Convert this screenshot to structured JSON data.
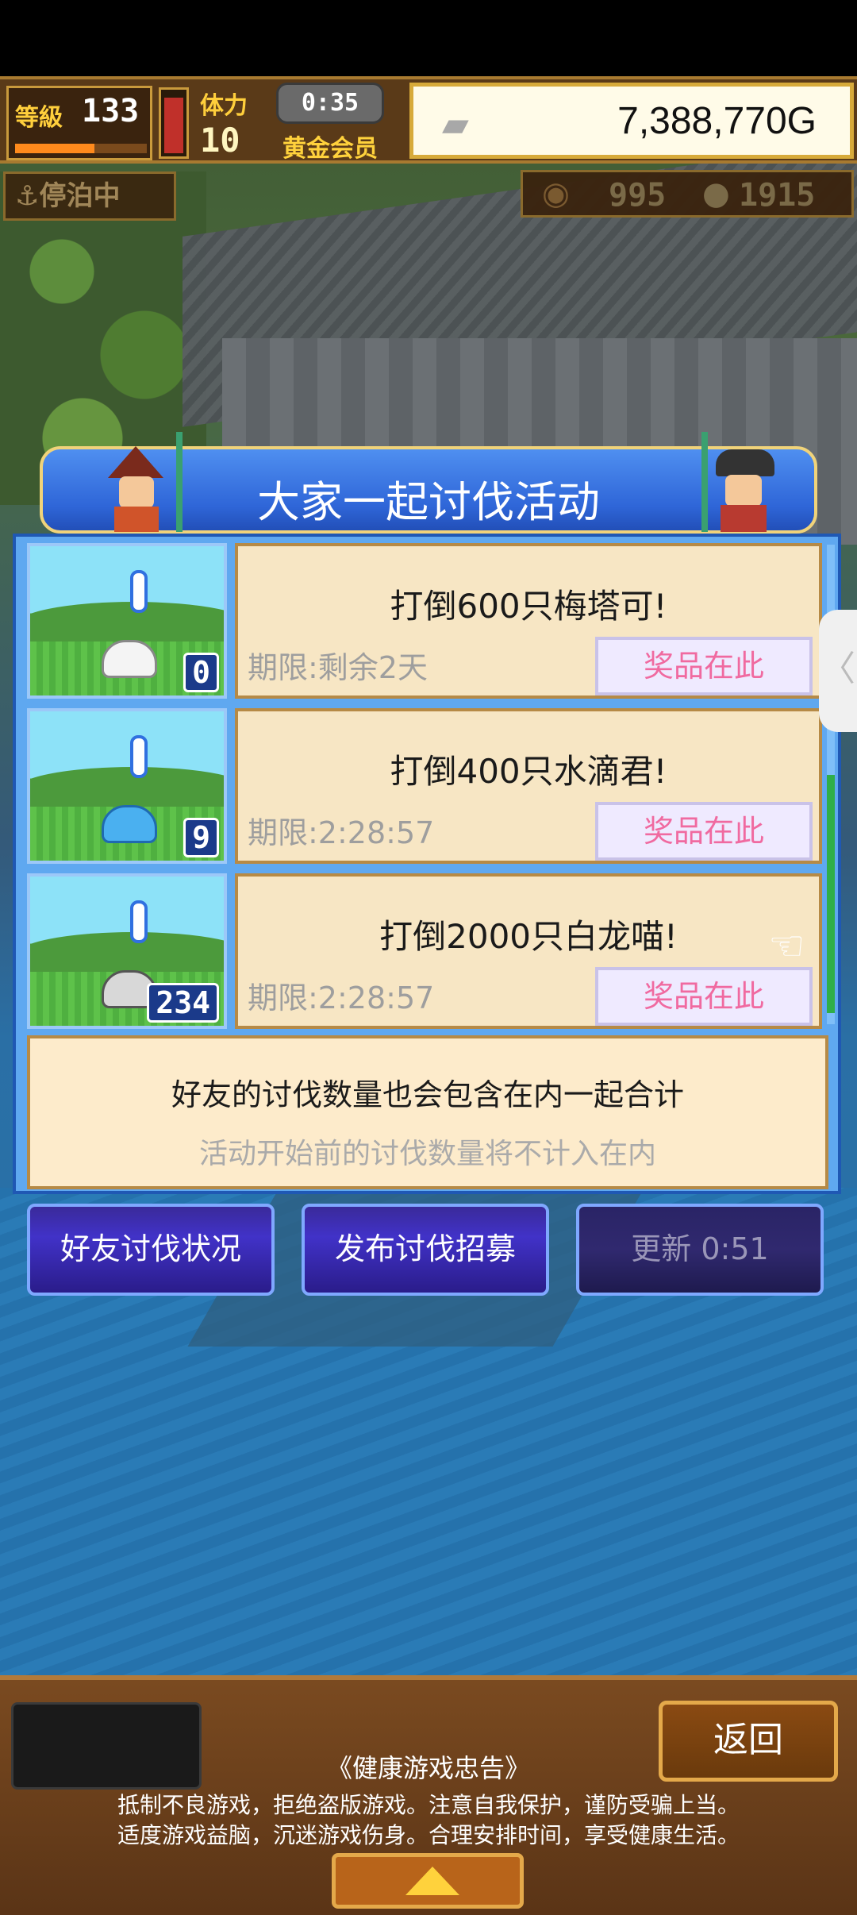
{
  "hud": {
    "level_label": "等級",
    "level": "133",
    "stamina_label": "体力",
    "stamina": "10",
    "timer": "0:35",
    "member": "黄金会员",
    "money": "7,388,770G",
    "docked": "停泊中",
    "res1": "995",
    "res2": "1915"
  },
  "event": {
    "title": "大家一起讨伐活动",
    "missions": [
      {
        "text": "打倒600只梅塔可!",
        "limit": "期限:剩余2天",
        "prize": "奖品在此",
        "count": "0"
      },
      {
        "text": "打倒400只水滴君!",
        "limit": "期限:2:28:57",
        "prize": "奖品在此",
        "count": "9"
      },
      {
        "text": "打倒2000只白龙喵!",
        "limit": "期限:2:28:57",
        "prize": "奖品在此",
        "count": "234"
      }
    ],
    "info_line1": "好友的讨伐数量也会包含在内一起合计",
    "info_line2": "活动开始前的讨伐数量将不计入在内"
  },
  "buttons": {
    "friend_status": "好友讨伐状况",
    "post_recruit": "发布讨伐招募",
    "refresh": "更新 0:51"
  },
  "bottom": {
    "back": "返回",
    "notice_title": "《健康游戏忠告》",
    "notice_line1": "抵制不良游戏，拒绝盗版游戏。注意自我保护，谨防受骗上当。",
    "notice_line2": "适度游戏益脑，沉迷游戏伤身。合理安排时间，享受健康生活。"
  },
  "icons": [
    "anchor-icon",
    "ingot-icon",
    "coin-icon",
    "medal-icon",
    "hand-cursor-icon",
    "chevron-left-icon",
    "arrow-up-icon"
  ]
}
